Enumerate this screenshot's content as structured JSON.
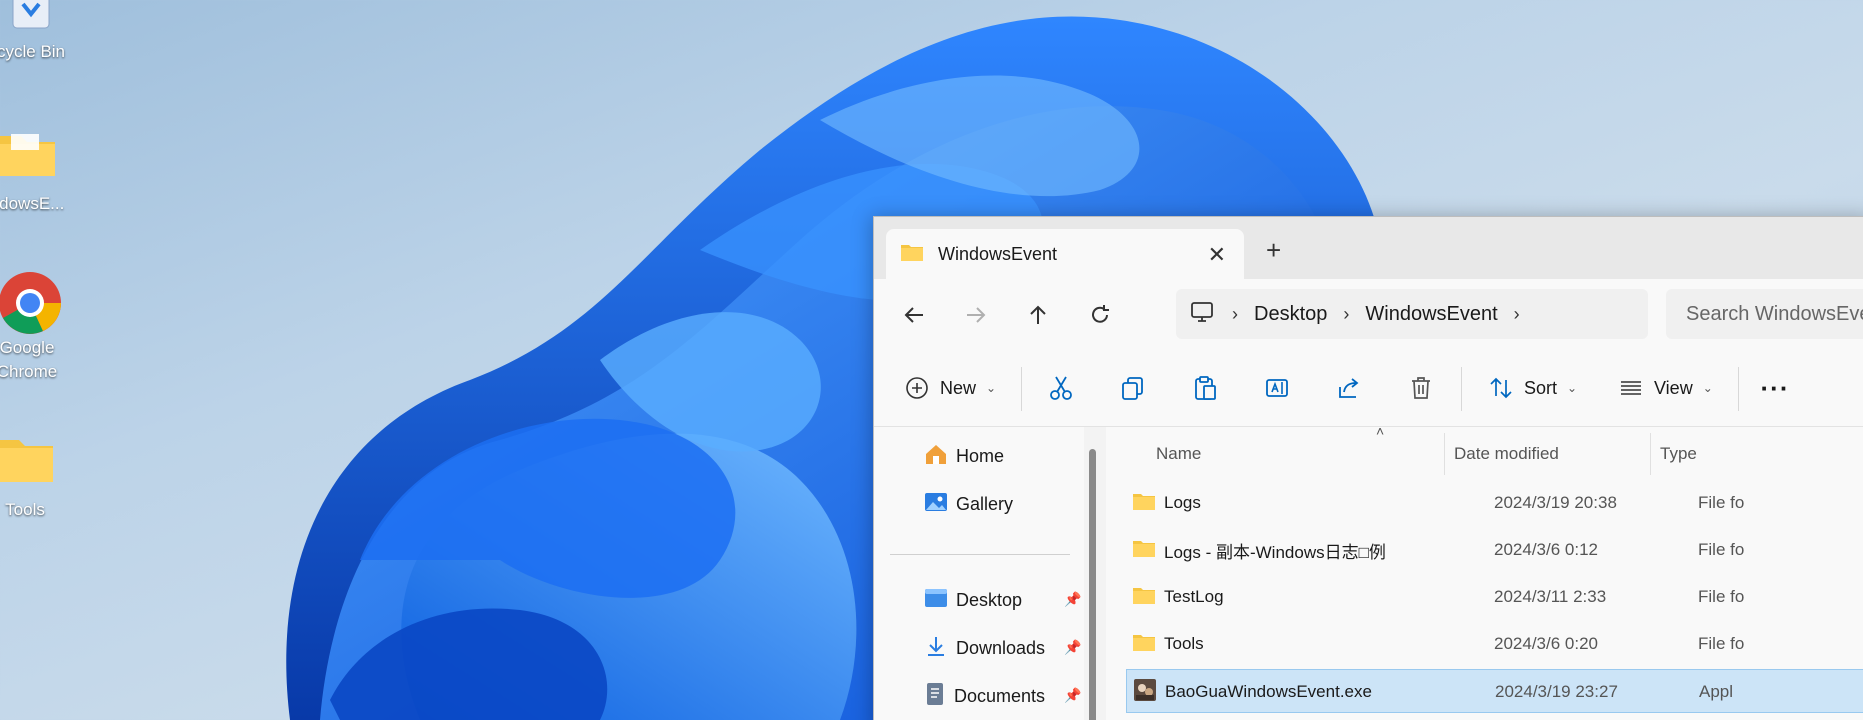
{
  "desktop": {
    "icons": [
      {
        "label": "cycle Bin",
        "icon": "recycle-bin-icon"
      },
      {
        "label": "ndowsE...",
        "icon": "folder-icon"
      },
      {
        "label": "Google Chrome",
        "icon": "chrome-icon"
      },
      {
        "label": "Tools",
        "icon": "folder-icon"
      }
    ]
  },
  "explorer": {
    "tab": {
      "title": "WindowsEvent",
      "close_icon": "close-icon",
      "new_tab_icon": "plus-icon"
    },
    "nav": {
      "back": "back-arrow-icon",
      "forward": "forward-arrow-icon",
      "up": "up-arrow-icon",
      "refresh": "refresh-icon"
    },
    "breadcrumb": [
      "Desktop",
      "WindowsEvent"
    ],
    "search_placeholder": "Search WindowsEvent",
    "toolbar": {
      "new_label": "New",
      "sort_label": "Sort",
      "view_label": "View",
      "icons": [
        "cut-icon",
        "copy-icon",
        "paste-icon",
        "rename-icon",
        "share-icon",
        "delete-icon",
        "more-icon"
      ]
    },
    "nav_pane": {
      "items": [
        {
          "label": "Home",
          "icon": "home-icon"
        },
        {
          "label": "Gallery",
          "icon": "gallery-icon"
        },
        {
          "label": "Desktop",
          "icon": "desktop-icon",
          "pinned": true
        },
        {
          "label": "Downloads",
          "icon": "download-icon",
          "pinned": true
        },
        {
          "label": "Documents",
          "icon": "documents-icon",
          "pinned": true
        }
      ]
    },
    "columns": {
      "name": "Name",
      "date": "Date modified",
      "type": "Type"
    },
    "files": [
      {
        "name": "Logs",
        "date": "2024/3/19 20:38",
        "type": "File fo",
        "icon": "folder-icon",
        "selected": false
      },
      {
        "name": "Logs - 副本-Windows日志□例",
        "date": "2024/3/6 0:12",
        "type": "File fo",
        "icon": "folder-icon",
        "selected": false
      },
      {
        "name": "TestLog",
        "date": "2024/3/11 2:33",
        "type": "File fo",
        "icon": "folder-icon",
        "selected": false
      },
      {
        "name": "Tools",
        "date": "2024/3/6 0:20",
        "type": "File fo",
        "icon": "folder-icon",
        "selected": false
      },
      {
        "name": "BaoGuaWindowsEvent.exe",
        "date": "2024/3/19 23:27",
        "type": "Appl",
        "icon": "application-icon",
        "selected": true
      }
    ],
    "colors": {
      "accent": "#0067c0",
      "selection": "#cce4f7",
      "folder": "#f5c542"
    }
  }
}
